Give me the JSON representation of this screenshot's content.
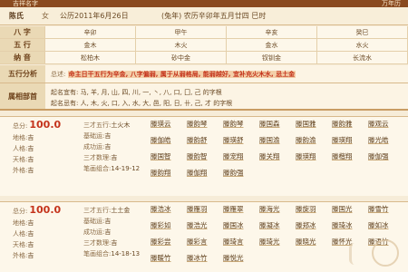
{
  "header": {
    "title": "吉祥名字",
    "right": "万年历"
  },
  "info": {
    "surname_label": "陈氏",
    "gender": "女",
    "solar_date": "公历2011年6月26日",
    "lunar_date": "(兔年) 农历辛卯年五月廿四 巳时"
  },
  "bazi": {
    "rows": [
      {
        "label": "八 字",
        "cells": [
          "辛卯",
          "甲午",
          "辛亥",
          "癸巳"
        ]
      },
      {
        "label": "五 行",
        "cells": [
          "金木",
          "木火",
          "金水",
          "水火"
        ]
      },
      {
        "label": "纳 音",
        "cells": [
          "松柏木",
          "砂中金",
          "钗钏金",
          "长流水"
        ]
      }
    ]
  },
  "wuxing": {
    "label": "五行分析",
    "prefix": "总述:",
    "highlight": "命主日干五行为辛金, 八字偏弱, 属于从弱格局, 能弱越好, 宜补充火木水, 忌土金"
  },
  "bushou": {
    "label": "属相部首",
    "lines": [
      "起名宜有: 马, 羊, 月, 山, 四, 川, 一, 丶, 八, 口, 囗, 己 的字根",
      "起名忌有: 人, 木, 火, 口, 入, 水, 大, 邑, 阳, 日, 卄, 己, 才 的字根"
    ]
  },
  "cards": [
    {
      "score_label": "总分:",
      "score": "100.0",
      "left_fields": [
        {
          "k": "地格:",
          "v": "吉"
        },
        {
          "k": "人格:",
          "v": "吉"
        },
        {
          "k": "天格:",
          "v": "吉"
        },
        {
          "k": "外格:",
          "v": "吉"
        }
      ],
      "mid_fields": [
        {
          "k": "三才五行:",
          "v": "土火木"
        },
        {
          "k": "基础运:",
          "v": "吉"
        },
        {
          "k": "成功运:",
          "v": "吉"
        },
        {
          "k": "三才数理:",
          "v": "吉"
        },
        {
          "k": "笔画组合:",
          "v": "14-19-12"
        }
      ],
      "names": [
        "滕瑛云",
        "滕韵琴",
        "滕韵琴",
        "滕国森",
        "滕国雅",
        "滕韵雅",
        "滕观云",
        "滕伽皓",
        "滕韵舒",
        "滕瑛舒",
        "滕国渝",
        "滕韵渝",
        "滕瑛翔",
        "滕光皓",
        "滕国智",
        "滕韵智",
        "滕宠翔",
        "滕关翔",
        "滕瑛翔",
        "滕楷翔",
        "滕伽强",
        "滕韵翔",
        "滕伽翔",
        "滕韵强"
      ]
    },
    {
      "score_label": "总分:",
      "score": "100.0",
      "left_fields": [
        {
          "k": "地格:",
          "v": "吉"
        },
        {
          "k": "人格:",
          "v": "吉"
        },
        {
          "k": "天格:",
          "v": "吉"
        },
        {
          "k": "外格:",
          "v": "吉"
        }
      ],
      "mid_fields": [
        {
          "k": "三才五行:",
          "v": "土土金"
        },
        {
          "k": "基础运:",
          "v": "吉"
        },
        {
          "k": "成功运:",
          "v": "吉"
        },
        {
          "k": "三才数理:",
          "v": "吉"
        },
        {
          "k": "笔画组合:",
          "v": "14-18-13"
        }
      ],
      "names": [
        "滕浩冰",
        "滕雁羽",
        "滕雁翠",
        "滕海光",
        "滕旋羽",
        "滕国光",
        "滕雪竹",
        "滕彩如",
        "滕浩光",
        "滕国冰",
        "滕凝冰",
        "滕郑冰",
        "滕琦冰",
        "滕如冰",
        "滕彩尝",
        "滕彩言",
        "滕琦言",
        "滕琦光",
        "滕晓光",
        "滕怀光",
        "滕语竹",
        "滕暖竹",
        "滕冰竹",
        "滕悦光"
      ]
    }
  ]
}
